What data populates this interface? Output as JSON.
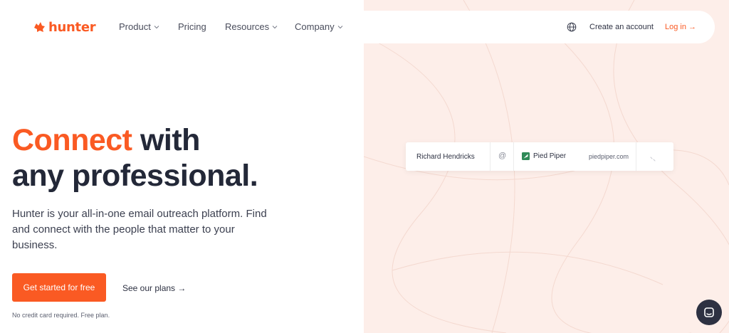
{
  "brand": {
    "name": "hunter",
    "accent": "#fa5a23"
  },
  "nav": {
    "items": [
      {
        "label": "Product",
        "has_dropdown": true
      },
      {
        "label": "Pricing",
        "has_dropdown": false
      },
      {
        "label": "Resources",
        "has_dropdown": true
      },
      {
        "label": "Company",
        "has_dropdown": true
      }
    ],
    "language_icon": "globe-icon",
    "create_account": "Create an account",
    "login": "Log in →"
  },
  "hero": {
    "title_accent": "Connect",
    "title_rest_line1": " with",
    "title_line2": "any professional.",
    "subtitle": "Hunter is your all-in-one email outreach platform. Find and connect with the people that matter to your business.",
    "cta": "Get started for free",
    "secondary_link": "See our plans →",
    "note": "No credit card required. Free plan."
  },
  "search_card": {
    "name": "Richard Hendricks",
    "at_symbol": "@",
    "company": "Pied Piper",
    "domain": "piedpiper.com",
    "company_icon": "pied-piper-logo-icon",
    "status_icon": "loading-icon"
  },
  "chat": {
    "icon": "chat-icon"
  },
  "colors": {
    "right_bg": "#fdeee9",
    "text_dark": "#232838",
    "chat_bg": "#2d3142"
  }
}
